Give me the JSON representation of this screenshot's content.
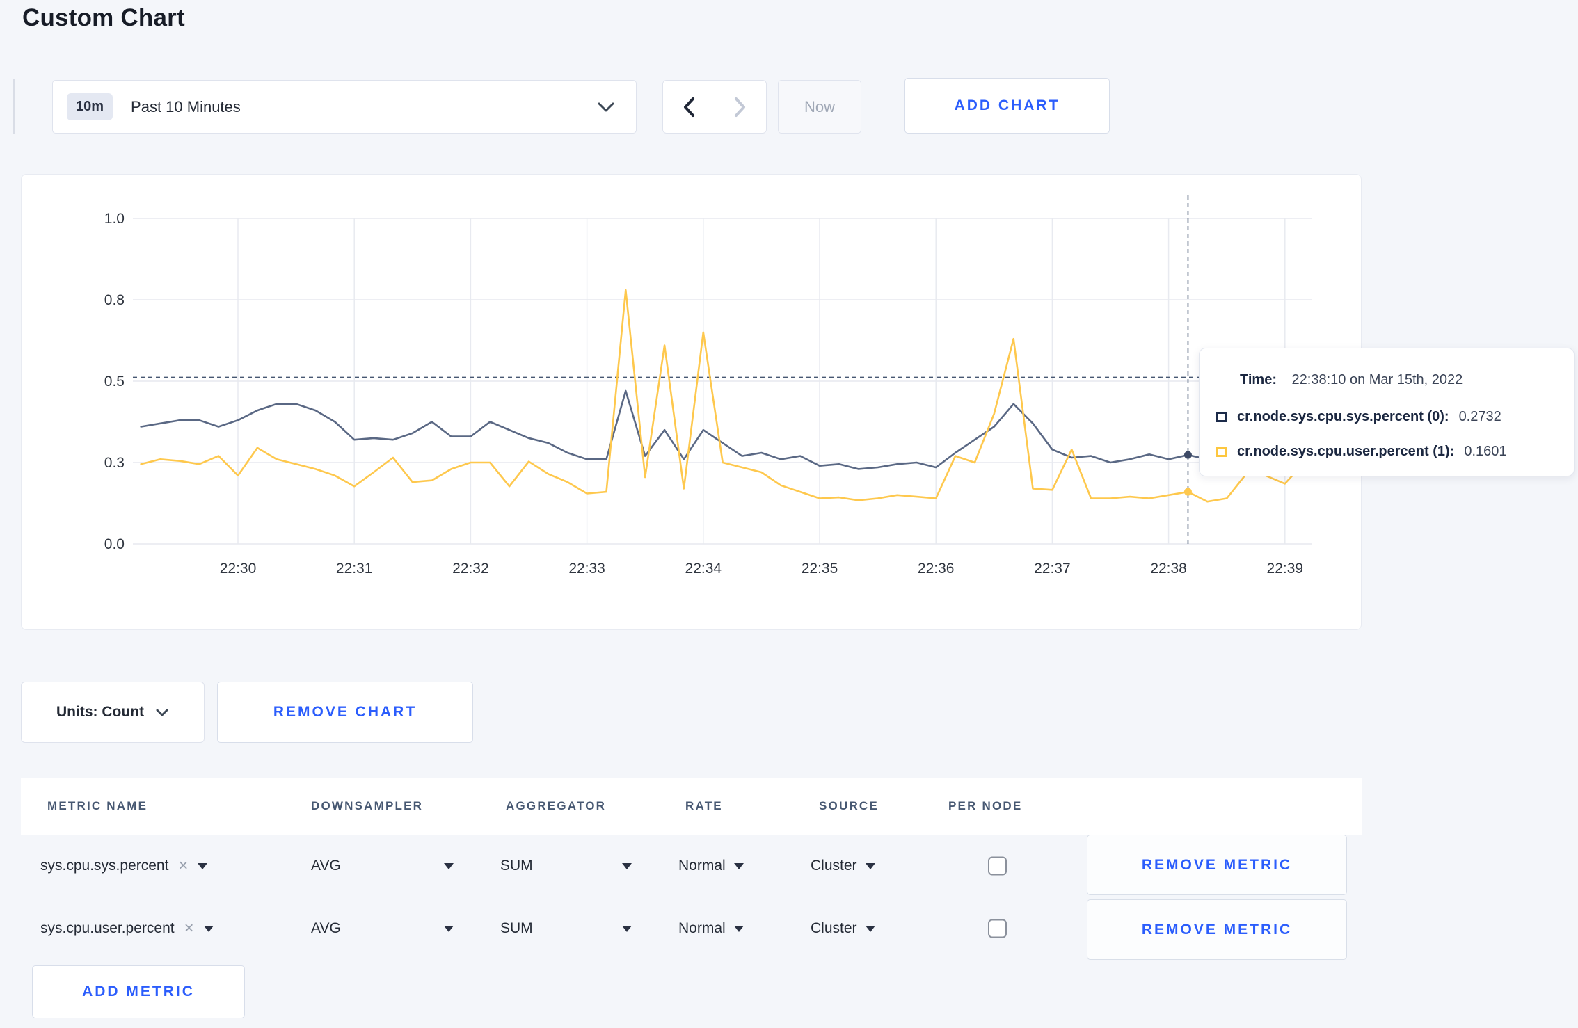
{
  "page": {
    "title": "Custom Chart"
  },
  "icons": {
    "clear": "×"
  },
  "toolbar": {
    "time_window_badge": "10m",
    "time_window_label": "Past 10 Minutes",
    "now_label": "Now",
    "add_chart_label": "ADD CHART"
  },
  "chart_data": {
    "type": "line",
    "title": "",
    "xlabel": "",
    "ylabel": "",
    "ylim": [
      0,
      1
    ],
    "grid": true,
    "legend_position": "none",
    "y_tick_labels": [
      "1.0",
      "0.8",
      "0.5",
      "0.3",
      "0.0"
    ],
    "y_tick_values": [
      1.0,
      0.75,
      0.5,
      0.25,
      0.0
    ],
    "x_ticks": [
      "22:30",
      "22:31",
      "22:32",
      "22:33",
      "22:34",
      "22:35",
      "22:36",
      "22:37",
      "22:38",
      "22:39"
    ],
    "date": "Mar 15th, 2022",
    "first_point_time": "22:29:10",
    "first_point_offset_seconds": -50,
    "point_interval_seconds": 10,
    "series": [
      {
        "name": "cr.node.sys.cpu.sys.percent (0)",
        "color": "#5a6884",
        "values": [
          0.36,
          0.37,
          0.38,
          0.38,
          0.36,
          0.38,
          0.41,
          0.43,
          0.43,
          0.41,
          0.375,
          0.32,
          0.325,
          0.32,
          0.34,
          0.375,
          0.33,
          0.33,
          0.375,
          0.35,
          0.325,
          0.31,
          0.28,
          0.26,
          0.26,
          0.47,
          0.27,
          0.35,
          0.26,
          0.35,
          0.31,
          0.27,
          0.28,
          0.26,
          0.27,
          0.24,
          0.245,
          0.23,
          0.235,
          0.245,
          0.25,
          0.235,
          0.28,
          0.32,
          0.36,
          0.43,
          0.37,
          0.29,
          0.265,
          0.27,
          0.25,
          0.26,
          0.275,
          0.26,
          0.2732,
          0.26,
          0.29,
          0.31,
          0.32,
          0.3,
          0.3
        ]
      },
      {
        "name": "cr.node.sys.cpu.user.percent (1)",
        "color": "#fec84d",
        "values": [
          0.245,
          0.26,
          0.255,
          0.245,
          0.27,
          0.21,
          0.295,
          0.26,
          0.245,
          0.23,
          0.21,
          0.177,
          0.22,
          0.265,
          0.19,
          0.195,
          0.23,
          0.25,
          0.25,
          0.177,
          0.253,
          0.215,
          0.19,
          0.155,
          0.16,
          0.78,
          0.205,
          0.61,
          0.17,
          0.65,
          0.25,
          0.235,
          0.22,
          0.18,
          0.16,
          0.14,
          0.143,
          0.134,
          0.14,
          0.15,
          0.145,
          0.14,
          0.27,
          0.25,
          0.4,
          0.63,
          0.17,
          0.166,
          0.29,
          0.14,
          0.14,
          0.145,
          0.14,
          0.15,
          0.1601,
          0.13,
          0.14,
          0.215,
          0.21,
          0.185,
          0.25
        ]
      }
    ],
    "crosshair": {
      "time": "22:38:10",
      "offset_seconds_from_first_tick": 490,
      "horizontal_guide_value": 0.512,
      "marker_values": [
        0.2732,
        0.1601
      ]
    }
  },
  "tooltip": {
    "time_label": "Time:",
    "time_value": "22:38:10 on Mar 15th, 2022",
    "rows": [
      {
        "label": "cr.node.sys.cpu.sys.percent (0):",
        "value": "0.2732",
        "color": "#1c2b4a"
      },
      {
        "label": "cr.node.sys.cpu.user.percent (1):",
        "value": "0.1601",
        "color": "#fdc73f"
      }
    ]
  },
  "chart_footer": {
    "units_label": "Units: Count",
    "remove_chart_label": "REMOVE CHART"
  },
  "metrics_table": {
    "headers": [
      "METRIC NAME",
      "DOWNSAMPLER",
      "AGGREGATOR",
      "RATE",
      "SOURCE",
      "PER NODE"
    ],
    "remove_metric_label": "REMOVE METRIC",
    "add_metric_label": "ADD METRIC",
    "rows": [
      {
        "metric": "sys.cpu.sys.percent",
        "downsampler": "AVG",
        "aggregator": "SUM",
        "rate": "Normal",
        "source": "Cluster",
        "per_node_checked": false
      },
      {
        "metric": "sys.cpu.user.percent",
        "downsampler": "AVG",
        "aggregator": "SUM",
        "rate": "Normal",
        "source": "Cluster",
        "per_node_checked": false
      }
    ]
  }
}
